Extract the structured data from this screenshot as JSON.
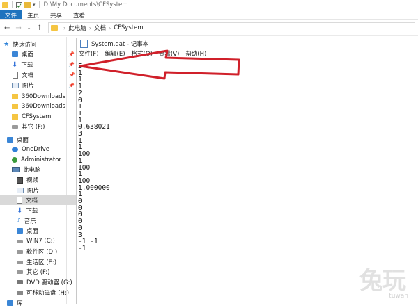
{
  "titlebar": {
    "path": "D:\\My Documents\\CFSystem"
  },
  "ribbon": {
    "tabs": [
      "文件",
      "主页",
      "共享",
      "查看"
    ]
  },
  "address": {
    "segments": [
      "此电脑",
      "文档",
      "CFSystem"
    ]
  },
  "sidebar": {
    "items": [
      {
        "label": "快速访问",
        "icon": "star-icon"
      },
      {
        "label": "桌面",
        "icon": "desktop-icon",
        "pinned": true
      },
      {
        "label": "下载",
        "icon": "download-icon",
        "pinned": true
      },
      {
        "label": "文档",
        "icon": "document-icon",
        "pinned": true
      },
      {
        "label": "图片",
        "icon": "picture-icon",
        "pinned": true
      },
      {
        "label": "360Downloads",
        "icon": "folder-icon"
      },
      {
        "label": "360Downloads",
        "icon": "folder-icon"
      },
      {
        "label": "CFSystem",
        "icon": "folder-icon"
      },
      {
        "label": "其它 (F:)",
        "icon": "drive-icon"
      },
      {
        "label": "桌面",
        "icon": "desktop-icon"
      },
      {
        "label": "OneDrive",
        "icon": "cloud-icon"
      },
      {
        "label": "Administrator",
        "icon": "user-icon"
      },
      {
        "label": "此电脑",
        "icon": "computer-icon"
      },
      {
        "label": "视频",
        "icon": "video-icon"
      },
      {
        "label": "图片",
        "icon": "picture-icon"
      },
      {
        "label": "文档",
        "icon": "document-icon",
        "selected": true
      },
      {
        "label": "下载",
        "icon": "download-icon"
      },
      {
        "label": "音乐",
        "icon": "music-icon"
      },
      {
        "label": "桌面",
        "icon": "desktop-icon"
      },
      {
        "label": "WIN7 (C:)",
        "icon": "drive-icon"
      },
      {
        "label": "软件区 (D:)",
        "icon": "drive-icon"
      },
      {
        "label": "生活区 (E:)",
        "icon": "drive-icon"
      },
      {
        "label": "其它 (F:)",
        "icon": "drive-icon"
      },
      {
        "label": "DVD 驱动器 (G:)",
        "icon": "dvd-icon"
      },
      {
        "label": "可移动磁盘 (H:)",
        "icon": "usb-icon"
      },
      {
        "label": "库",
        "icon": "library-icon"
      }
    ]
  },
  "notepad": {
    "title": "System.dat - 记事本",
    "menu": [
      "文件(F)",
      "编辑(E)",
      "格式(O)",
      "查看(V)",
      "帮助(H)"
    ],
    "lines": [
      "5",
      "1",
      "1",
      "1",
      "2",
      "0",
      "1",
      "1",
      "1",
      "0.638021",
      "3",
      "1",
      "1",
      "100",
      "1",
      "100",
      "1",
      "100",
      "1.000000",
      "1",
      "0",
      "0",
      "0",
      "0",
      "0",
      "3",
      "-1 -1",
      "-1"
    ]
  },
  "colors": {
    "accent": "#1e73be",
    "arrow": "#d0202a"
  },
  "watermark": {
    "text": "兔玩",
    "small": "tuwan"
  }
}
